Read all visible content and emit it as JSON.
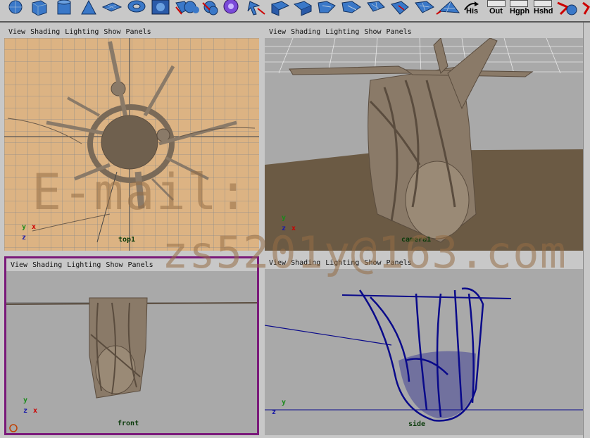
{
  "shelf": {
    "labels": {
      "his": "His",
      "out": "Out",
      "hgph": "Hgph",
      "hshd": "Hshd"
    }
  },
  "menu": {
    "view": "View",
    "shading": "Shading",
    "lighting": "Lighting",
    "show": "Show",
    "panels": "Panels"
  },
  "panels": {
    "top": {
      "camera": "top1"
    },
    "persp": {
      "camera": "camera1"
    },
    "front": {
      "camera": "front"
    },
    "side": {
      "camera": "side"
    }
  },
  "axes": {
    "x": "x",
    "y": "y",
    "z": "z"
  },
  "watermark": {
    "line1": "E-mail:",
    "line2": "zs5201y@163.com"
  },
  "colors": {
    "top_bg": "#dcb383",
    "viewport_bg": "#a9a9a9",
    "active_border": "#7a1a7a",
    "wire": "#0a0a8a",
    "root": "#8a7a68"
  }
}
